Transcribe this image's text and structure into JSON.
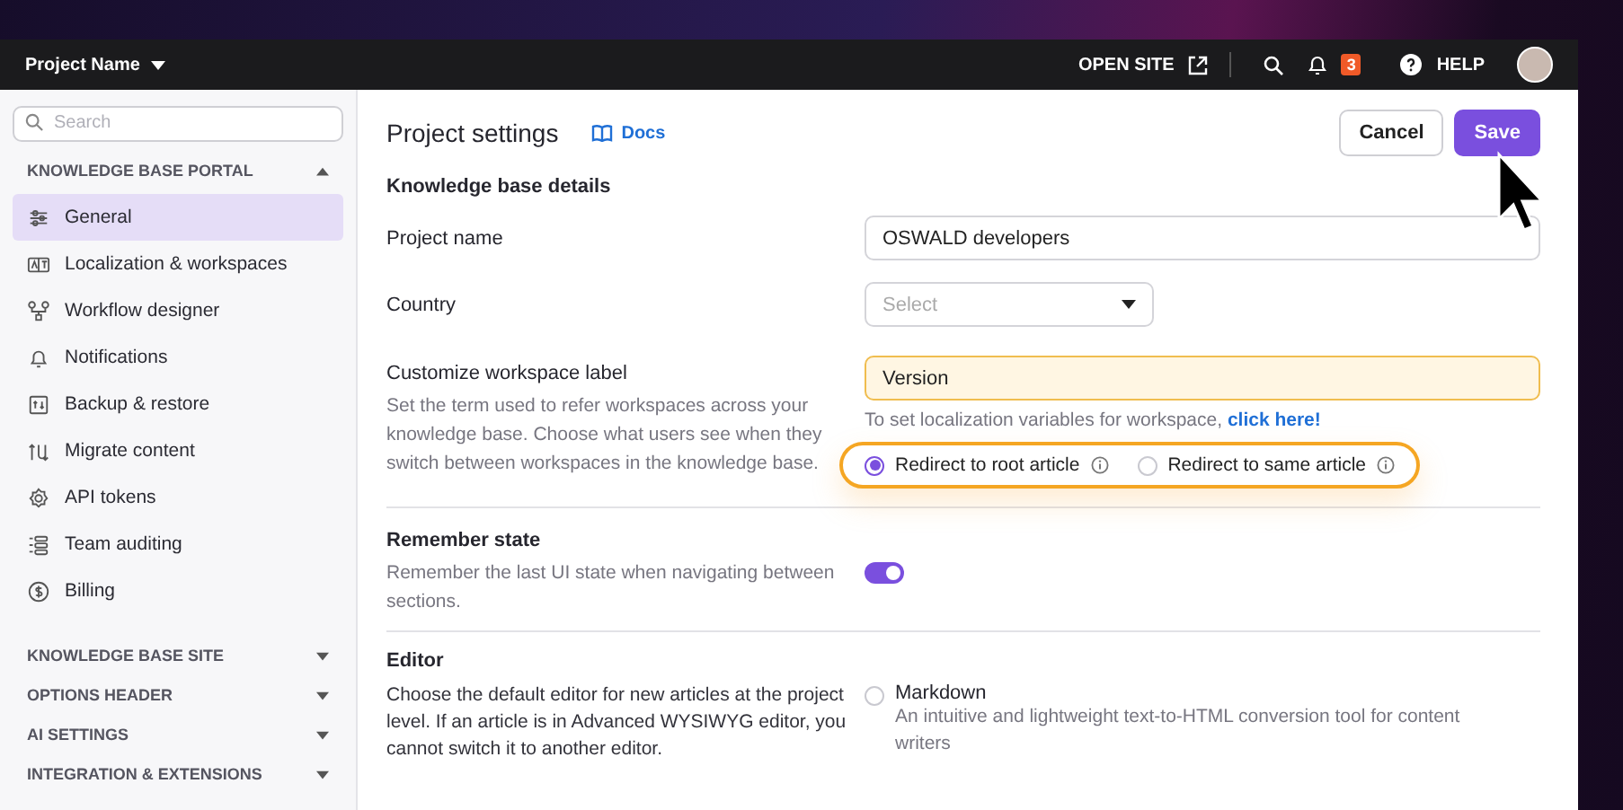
{
  "topbar": {
    "project": "Project Name",
    "open_site": "OPEN SITE",
    "notifications": "3",
    "help": "HELP"
  },
  "sidebar": {
    "search": {
      "placeholder": "Search"
    },
    "sections": [
      {
        "title": "KNOWLEDGE BASE PORTAL",
        "expanded": true,
        "items": [
          {
            "label": "General",
            "selected": true
          },
          {
            "label": "Localization & workspaces",
            "selected": false
          },
          {
            "label": "Workflow designer",
            "selected": false
          },
          {
            "label": "Notifications",
            "selected": false
          },
          {
            "label": "Backup & restore",
            "selected": false
          },
          {
            "label": "Migrate content",
            "selected": false
          },
          {
            "label": "API tokens",
            "selected": false
          },
          {
            "label": "Team auditing",
            "selected": false
          },
          {
            "label": "Billing",
            "selected": false
          }
        ]
      },
      {
        "title": "KNOWLEDGE BASE SITE",
        "expanded": false
      },
      {
        "title": "OPTIONS HEADER",
        "expanded": false
      },
      {
        "title": "AI SETTINGS",
        "expanded": false
      },
      {
        "title": "INTEGRATION & EXTENSIONS",
        "expanded": false
      }
    ]
  },
  "header": {
    "title": "Project settings",
    "docs": "Docs",
    "buttons": [
      {
        "label": "Cancel",
        "kind": "secondary"
      },
      {
        "label": "Save",
        "kind": "primary"
      }
    ]
  },
  "details": {
    "heading": "Knowledge base details",
    "project_name": {
      "label": "Project name",
      "value": "OSWALD developers"
    },
    "country": {
      "label": "Country",
      "placeholder": "Select"
    },
    "workspace": {
      "label": "Customize workspace label",
      "description": "Set the term used to refer workspaces across your knowledge base. Choose what users see when they switch between workspaces in the knowledge base.",
      "value": "Version",
      "hint": "To set localization variables for workspace,",
      "hint_link": "click here!",
      "options": [
        {
          "label": "Redirect to root article",
          "selected": true
        },
        {
          "label": "Redirect to same article",
          "selected": false
        }
      ]
    }
  },
  "remember": {
    "heading": "Remember state",
    "description": "Remember the last UI state when navigating between sections.",
    "on": true
  },
  "editor": {
    "heading": "Editor",
    "description": "Choose the default editor for new articles at the project level. If an article is in Advanced WYSIWYG editor, you cannot switch it to another editor.",
    "options": [
      {
        "label": "Markdown",
        "description": "An intuitive and lightweight text-to-HTML conversion tool for content writers",
        "selected": false
      }
    ]
  }
}
